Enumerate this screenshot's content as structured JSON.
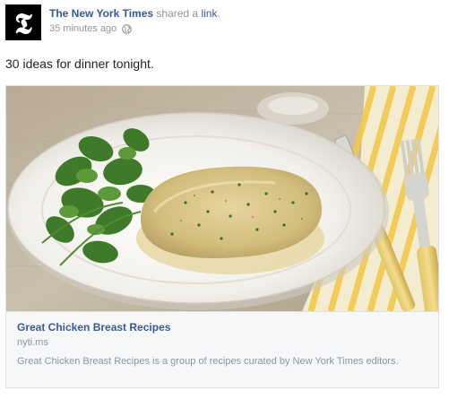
{
  "post": {
    "page_name": "The New York Times",
    "shared_text": "shared a",
    "link_word": "link",
    "period": ".",
    "avatar_glyph": "𝕿",
    "timestamp": "35 minutes ago",
    "privacy_icon": "globe-icon",
    "status_text": "30 ideas for dinner tonight."
  },
  "link_card": {
    "title": "Great Chicken Breast Recipes",
    "domain": "nyti.ms",
    "description": "Great Chicken Breast Recipes is a group of recipes curated by New York Times editors.",
    "image_subject": "chicken-breast-dish-photo"
  },
  "colors": {
    "link_blue": "#365899",
    "card_title_blue": "#3b5998",
    "meta_gray": "#90949c",
    "card_bg": "#f6f7f9"
  }
}
